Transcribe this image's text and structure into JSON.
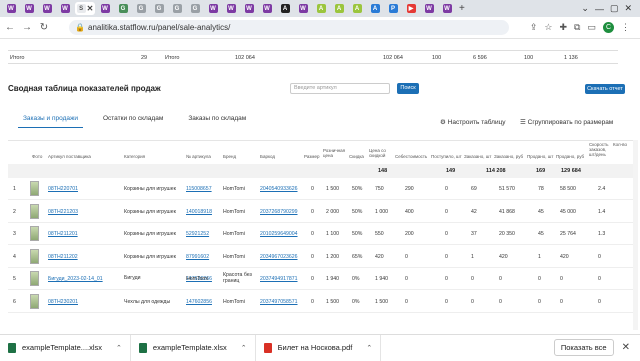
{
  "browser": {
    "tabs": [
      {
        "letter": "W",
        "color": "#7d3aa3"
      },
      {
        "letter": "W",
        "color": "#7d3aa3"
      },
      {
        "letter": "W",
        "color": "#7d3aa3"
      },
      {
        "letter": "W",
        "color": "#7d3aa3"
      },
      {
        "letter": "S",
        "color": "#ffffff",
        "active": true
      },
      {
        "letter": "W",
        "color": "#7d3aa3"
      },
      {
        "letter": "G",
        "color": "#4a8f5a"
      },
      {
        "letter": "G",
        "color": "#9aa0a6"
      },
      {
        "letter": "G",
        "color": "#9aa0a6"
      },
      {
        "letter": "G",
        "color": "#9aa0a6"
      },
      {
        "letter": "G",
        "color": "#9aa0a6"
      },
      {
        "letter": "W",
        "color": "#7d3aa3"
      },
      {
        "letter": "W",
        "color": "#7d3aa3"
      },
      {
        "letter": "W",
        "color": "#7d3aa3"
      },
      {
        "letter": "W",
        "color": "#7d3aa3"
      },
      {
        "letter": "A",
        "color": "#222222"
      },
      {
        "letter": "W",
        "color": "#7d3aa3"
      },
      {
        "letter": "A",
        "color": "#9bc53d"
      },
      {
        "letter": "A",
        "color": "#9bc53d"
      },
      {
        "letter": "A",
        "color": "#9bc53d"
      },
      {
        "letter": "A",
        "color": "#2a7bd6"
      },
      {
        "letter": "P",
        "color": "#2a7bd6"
      },
      {
        "letter": "▶",
        "color": "#e53935"
      },
      {
        "letter": "W",
        "color": "#7d3aa3"
      },
      {
        "letter": "W",
        "color": "#7d3aa3"
      }
    ],
    "active_close": "✕",
    "new_tab": "+",
    "url": "analitika.statflow.ru/panel/sale-analytics/",
    "profile_letter": "C"
  },
  "top_summary": {
    "label_left": "Итого",
    "value_left": "29",
    "label_mid": "Итого",
    "value_mid": "102 064",
    "v1": "102 064",
    "v2": "100",
    "v3": "6 596",
    "v4": "100",
    "v5": "1 136"
  },
  "page": {
    "title": "Сводная таблица показателей продаж",
    "search_placeholder": "Введите артикул",
    "find_label": "Поиск",
    "download_label": "Скачать отчет",
    "subtabs": [
      "Заказы и продажи",
      "Остатки по складам",
      "Заказы по складам"
    ],
    "setup_label": "Настроить таблицу",
    "group_label": "Сгруппировать по размерам"
  },
  "table": {
    "headers": [
      "Фото",
      "Артикул поставщика",
      "Категория",
      "№ артикула",
      "Бренд",
      "Баркод",
      "Размер",
      "Розничная цена",
      "Скидка",
      "Цена со скидкой",
      "Себестоимость",
      "Поступило, шт",
      "Заказано, шт",
      "Заказано, руб",
      "Продано, шт",
      "Продано, руб",
      "Скорость заказов, шт/день",
      "Кол-во"
    ],
    "totals": {
      "received": "148",
      "ordered": "149",
      "ordered_rub": "114 208",
      "sold": "169",
      "sold_rub": "129 684"
    },
    "rows": [
      {
        "n": "1",
        "sku": "08ТН220701",
        "cat": "Корзины для игрушек",
        "art": "115008657",
        "brand": "HomTomi",
        "barcode": "2040540933626",
        "size": "0",
        "price": "1 500",
        "disc": "50%",
        "dprice": "750",
        "cost": "290",
        "recv": "0",
        "ord": "69",
        "ord_rub": "51 570",
        "sold": "78",
        "sold_rub": "58 500",
        "speed": "2.4"
      },
      {
        "n": "2",
        "sku": "08ТН221203",
        "cat": "Корзины для игрушек",
        "art": "140018918",
        "brand": "HomTomi",
        "barcode": "2037268790299",
        "size": "0",
        "price": "2 000",
        "disc": "50%",
        "dprice": "1 000",
        "cost": "400",
        "recv": "0",
        "ord": "42",
        "ord_rub": "41 868",
        "sold": "45",
        "sold_rub": "45 000",
        "speed": "1.4"
      },
      {
        "n": "3",
        "sku": "08ТН211201",
        "cat": "Корзины для игрушек",
        "art": "52921252",
        "brand": "HomTomi",
        "barcode": "2010259649004",
        "size": "0",
        "price": "1 100",
        "disc": "50%",
        "dprice": "550",
        "cost": "200",
        "recv": "0",
        "ord": "37",
        "ord_rub": "20 350",
        "sold": "45",
        "sold_rub": "25 764",
        "speed": "1.3"
      },
      {
        "n": "4",
        "sku": "08ТН211202",
        "cat": "Корзины для игрушек",
        "art": "87991602",
        "brand": "HomTomi",
        "barcode": "2034967023626",
        "size": "0",
        "price": "1 200",
        "disc": "65%",
        "dprice": "420",
        "cost": "0",
        "recv": "0",
        "ord": "1",
        "ord_rub": "420",
        "sold": "1",
        "sold_rub": "420",
        "speed": "0"
      },
      {
        "n": "5",
        "sku": "Бигуди_2023-02-14_01",
        "cat": "Бигуди",
        "art": "147636266",
        "brand": "HomTomi",
        "barcode": "2037494917871",
        "size": "0",
        "price": "1 940",
        "disc": "0%",
        "dprice": "1 940",
        "cost": "0",
        "recv": "0",
        "ord": "0",
        "ord_rub": "0",
        "sold": "0",
        "sold_rub": "0",
        "speed": "0",
        "cat2": "Красота без границ"
      },
      {
        "n": "6",
        "sku": "08ТН230201",
        "cat": "Чехлы для одежды",
        "art": "147602856",
        "brand": "HomTomi",
        "barcode": "2037497058571",
        "size": "0",
        "price": "1 500",
        "disc": "0%",
        "dprice": "1 500",
        "cost": "0",
        "recv": "0",
        "ord": "0",
        "ord_rub": "0",
        "sold": "0",
        "sold_rub": "0",
        "speed": "0"
      }
    ]
  },
  "downloads": {
    "items": [
      {
        "name": "exampleTemplate....xlsx",
        "color": "#1e7145"
      },
      {
        "name": "exampleTemplate.xlsx",
        "color": "#1e7145"
      },
      {
        "name": "Билет на Носкова.pdf",
        "color": "#d93025"
      }
    ],
    "show_all": "Показать все",
    "close": "✕"
  }
}
